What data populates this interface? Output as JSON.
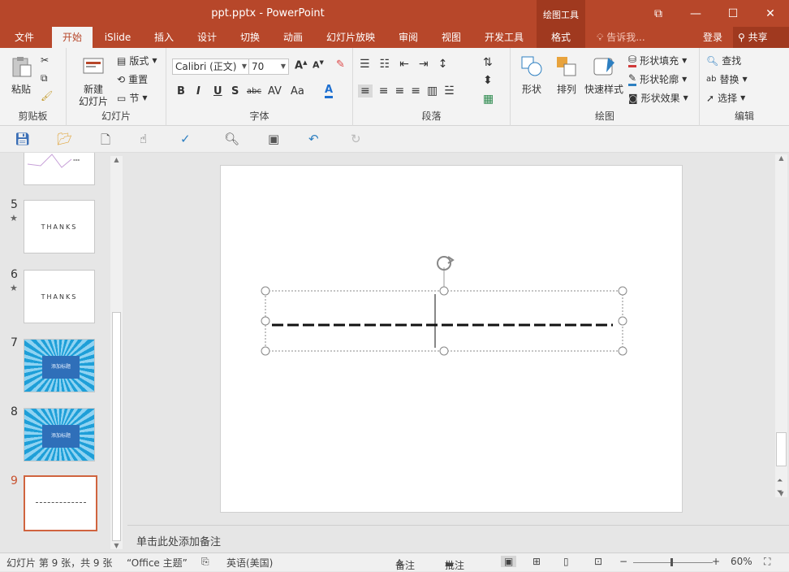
{
  "window": {
    "title": "ppt.pptx - PowerPoint",
    "context_tools": "绘图工具",
    "buttons": [
      "⧉",
      "—",
      "☐",
      "✕"
    ]
  },
  "tabs": [
    "文件",
    "开始",
    "iSlide",
    "插入",
    "设计",
    "切换",
    "动画",
    "幻灯片放映",
    "审阅",
    "视图",
    "开发工具",
    "格式"
  ],
  "tell_me": "告诉我...",
  "login": "登录",
  "share": "共享",
  "ribbon": {
    "clipboard": {
      "label": "剪贴板",
      "paste": "粘贴"
    },
    "slides": {
      "label": "幻灯片",
      "new_slide_1": "新建",
      "new_slide_2": "幻灯片",
      "layout": "版式",
      "reset": "重置",
      "section": "节"
    },
    "font": {
      "label": "字体",
      "font_name": "Calibri (正文)",
      "font_size": "70"
    },
    "paragraph": {
      "label": "段落"
    },
    "drawing": {
      "label": "绘图",
      "shapes": "形状",
      "arrange": "排列",
      "quick_styles": "快速样式",
      "fill": "形状填充",
      "outline": "形状轮廓",
      "effects": "形状效果"
    },
    "editing": {
      "label": "编辑",
      "find": "查找",
      "replace": "替换",
      "select": "选择"
    }
  },
  "thumbnails": [
    {
      "num": "5",
      "text": "THANKS"
    },
    {
      "num": "6",
      "text": "THANKS"
    },
    {
      "num": "7",
      "text": "添加标题"
    },
    {
      "num": "8",
      "text": "添加标题"
    },
    {
      "num": "9",
      "text": ""
    }
  ],
  "notes_placeholder": "单击此处添加备注",
  "status": {
    "slide_info": "幻灯片 第 9 张，共 9 张",
    "theme": "“Office 主题”",
    "language": "英语(美国)",
    "notes": "备注",
    "comments": "批注",
    "zoom": "60%"
  },
  "colors": {
    "accent": "#b7472a",
    "accent_dark": "#a0391f"
  }
}
